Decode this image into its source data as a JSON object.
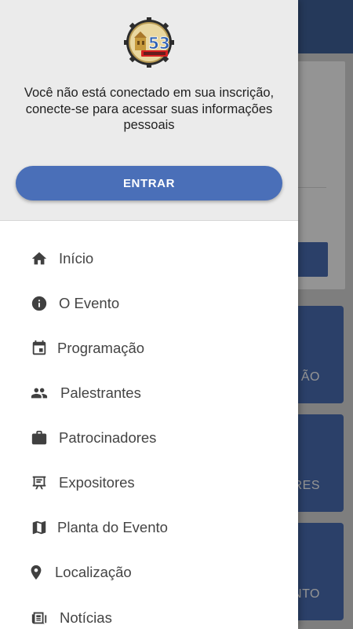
{
  "background": {
    "tiles": [
      {
        "label": "ÃO"
      },
      {
        "label": "RES"
      },
      {
        "label": "ENTO"
      }
    ]
  },
  "drawer": {
    "header": {
      "message": "Você não está conectado em sua inscrição, conecte-se para acessar suas informações pessoais",
      "login_label": "ENTRAR"
    },
    "items": [
      {
        "label": "Início",
        "icon": "home-icon"
      },
      {
        "label": "O Evento",
        "icon": "info-icon"
      },
      {
        "label": "Programação",
        "icon": "calendar-icon"
      },
      {
        "label": "Palestrantes",
        "icon": "people-icon"
      },
      {
        "label": "Patrocinadores",
        "icon": "briefcase-icon"
      },
      {
        "label": "Expositores",
        "icon": "easel-icon"
      },
      {
        "label": "Planta do Evento",
        "icon": "map-icon"
      },
      {
        "label": "Localização",
        "icon": "location-pin-icon"
      },
      {
        "label": "Notícias",
        "icon": "newspaper-icon"
      }
    ]
  },
  "colors": {
    "primary": "#4a6fb8",
    "appbar": "#40629c",
    "header_bg": "#ebebeb"
  }
}
